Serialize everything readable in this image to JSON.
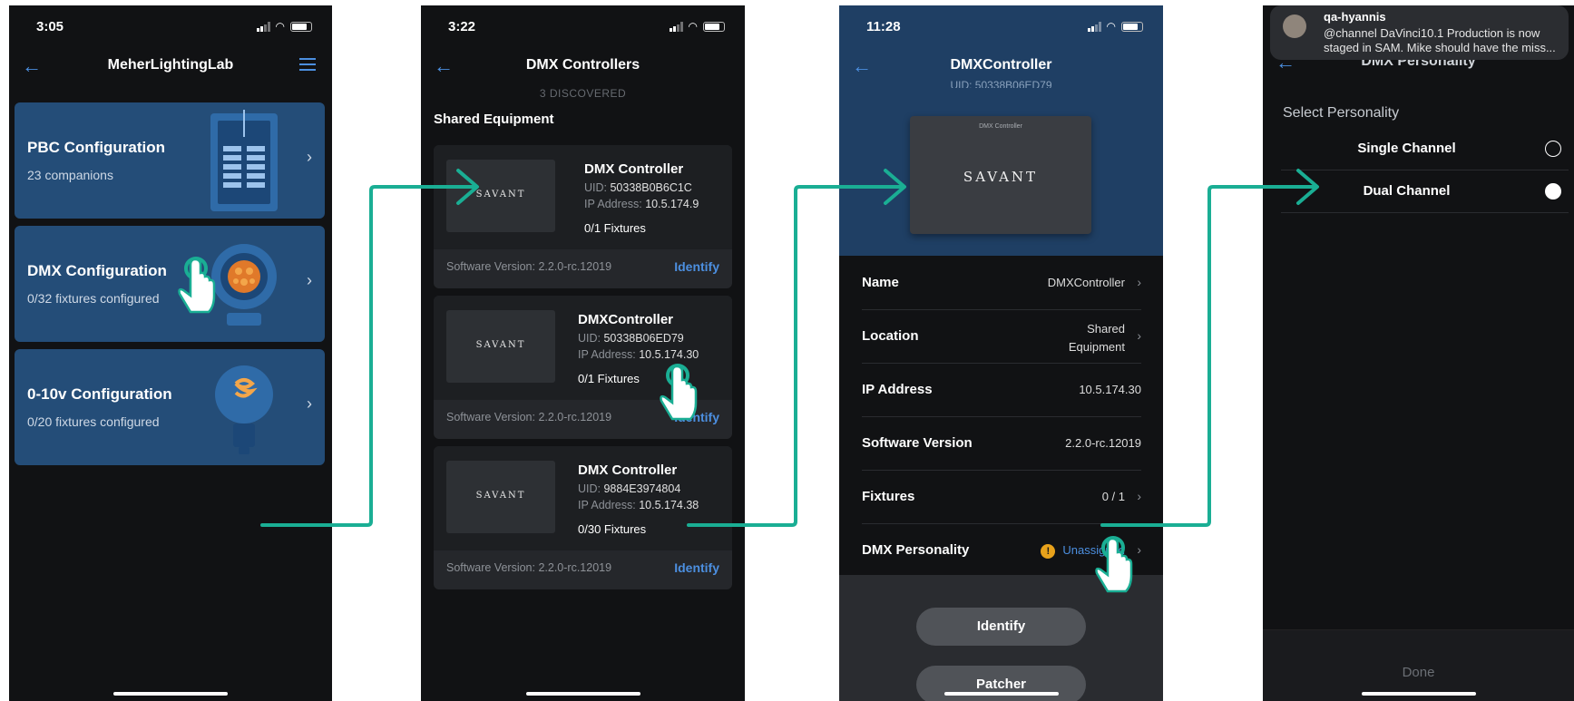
{
  "accent_color": "#1aae94",
  "link_color": "#4c8fe0",
  "screen1": {
    "time": "3:05",
    "title": "MeherLightingLab",
    "cards": [
      {
        "title": "PBC Configuration",
        "subtitle": "23 companions"
      },
      {
        "title": "DMX Configuration",
        "subtitle": "0/32 fixtures configured"
      },
      {
        "title": "0-10v Configuration",
        "subtitle": "0/20 fixtures configured"
      }
    ]
  },
  "screen2": {
    "time": "3:22",
    "title": "DMX Controllers",
    "discovered": "3 DISCOVERED",
    "section": "Shared Equipment",
    "devices": [
      {
        "name": "DMX Controller",
        "uid_label": "UID:",
        "uid": "50338B0B6C1C",
        "ip_label": "IP Address:",
        "ip": "10.5.174.9",
        "fixtures": "0/1 Fixtures",
        "software": "Software Version: 2.2.0-rc.12019",
        "action": "Identify",
        "image_brand": "SAVANT"
      },
      {
        "name": "DMXController",
        "uid_label": "UID:",
        "uid": "50338B06ED79",
        "ip_label": "IP Address:",
        "ip": "10.5.174.30",
        "fixtures": "0/1 Fixtures",
        "software": "Software Version: 2.2.0-rc.12019",
        "action": "Identify",
        "image_brand": "SAVANT"
      },
      {
        "name": "DMX Controller",
        "uid_label": "UID:",
        "uid": "9884E3974804",
        "ip_label": "IP Address:",
        "ip": "10.5.174.38",
        "fixtures": "0/30 Fixtures",
        "software": "Software Version: 2.2.0-rc.12019",
        "action": "Identify",
        "image_brand": "SAVANT"
      }
    ]
  },
  "screen3": {
    "time": "11:28",
    "title": "DMXController",
    "uid_partial": "UID: 50338B06ED79",
    "image_brand": "SAVANT",
    "image_label": "DMX Controller",
    "rows": [
      {
        "label": "Name",
        "value": "DMXController"
      },
      {
        "label": "Location",
        "value_line1": "Shared",
        "value_line2": "Equipment"
      },
      {
        "label": "IP Address",
        "value": "10.5.174.30"
      },
      {
        "label": "Software Version",
        "value": "2.2.0-rc.12019"
      },
      {
        "label": "Fixtures",
        "value": "0 / 1"
      },
      {
        "label": "DMX Personality",
        "value": "Unassigned"
      }
    ],
    "buttons": {
      "identify": "Identify",
      "patcher": "Patcher"
    }
  },
  "screen4": {
    "title": "DMX Personality",
    "notification": {
      "sender": "qa-hyannis",
      "message": "@channel DaVinci10.1 Production is now staged in SAM. Mike should have the miss..."
    },
    "select_label": "Select Personality",
    "options": [
      {
        "label": "Single Channel",
        "selected": false
      },
      {
        "label": "Dual Channel",
        "selected": true
      }
    ],
    "done": "Done"
  }
}
